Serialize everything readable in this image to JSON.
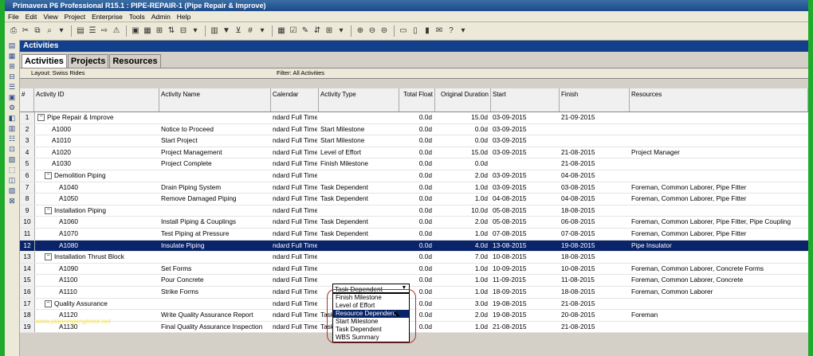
{
  "app": {
    "title": "Primavera P6 Professional R15.1 : PIPE-REPAIR-1 (Pipe Repair & Improve)"
  },
  "menu": [
    "File",
    "Edit",
    "View",
    "Project",
    "Enterprise",
    "Tools",
    "Admin",
    "Help"
  ],
  "section": {
    "title": "Activities"
  },
  "tabs": [
    "Activities",
    "Projects",
    "Resources"
  ],
  "filterbar": {
    "layout": "Layout: Swiss Rides",
    "filter": "Filter: All Activities"
  },
  "columns": {
    "num": "#",
    "id": "Activity ID",
    "name": "Activity Name",
    "calendar": "Calendar",
    "type": "Activity Type",
    "float": "Total Float",
    "duration": "Original Duration",
    "start": "Start",
    "finish": "Finish",
    "resources": "Resources"
  },
  "rows": [
    {
      "num": "1",
      "indent": 0,
      "exp": "−",
      "id": "Pipe Repair & Improve",
      "name": "",
      "cal": "ndard Full Time",
      "type": "",
      "float": "0.0d",
      "dur": "15.0d",
      "start": "03-09-2015",
      "finish": "21-09-2015",
      "res": ""
    },
    {
      "num": "2",
      "indent": 2,
      "exp": "",
      "id": "A1000",
      "name": "Notice to Proceed",
      "cal": "ndard Full Time",
      "type": "Start Milestone",
      "float": "0.0d",
      "dur": "0.0d",
      "start": "03-09-2015",
      "finish": "",
      "res": ""
    },
    {
      "num": "3",
      "indent": 2,
      "exp": "",
      "id": "A1010",
      "name": "Start Project",
      "cal": "ndard Full Time",
      "type": "Start Milestone",
      "float": "0.0d",
      "dur": "0.0d",
      "start": "03-09-2015",
      "finish": "",
      "res": ""
    },
    {
      "num": "4",
      "indent": 2,
      "exp": "",
      "id": "A1020",
      "name": "Project Management",
      "cal": "ndard Full Time",
      "type": "Level of Effort",
      "float": "0.0d",
      "dur": "15.0d",
      "start": "03-09-2015",
      "finish": "21-08-2015",
      "res": "Project Manager"
    },
    {
      "num": "5",
      "indent": 2,
      "exp": "",
      "id": "A1030",
      "name": "Project Complete",
      "cal": "ndard Full Time",
      "type": "Finish Milestone",
      "float": "0.0d",
      "dur": "0.0d",
      "start": "",
      "finish": "21-08-2015",
      "res": ""
    },
    {
      "num": "6",
      "indent": 1,
      "exp": "−",
      "id": "Demolition Piping",
      "name": "",
      "cal": "ndard Full Time",
      "type": "",
      "float": "0.0d",
      "dur": "2.0d",
      "start": "03-09-2015",
      "finish": "04-08-2015",
      "res": ""
    },
    {
      "num": "7",
      "indent": 3,
      "exp": "",
      "id": "A1040",
      "name": "Drain Piping System",
      "cal": "ndard Full Time",
      "type": "Task Dependent",
      "float": "0.0d",
      "dur": "1.0d",
      "start": "03-09-2015",
      "finish": "03-08-2015",
      "res": "Foreman, Common Laborer, Pipe Fitter"
    },
    {
      "num": "8",
      "indent": 3,
      "exp": "",
      "id": "A1050",
      "name": "Remove Damaged Piping",
      "cal": "ndard Full Time",
      "type": "Task Dependent",
      "float": "0.0d",
      "dur": "1.0d",
      "start": "04-08-2015",
      "finish": "04-08-2015",
      "res": "Foreman, Common Laborer, Pipe Fitter"
    },
    {
      "num": "9",
      "indent": 1,
      "exp": "−",
      "id": "Installation Piping",
      "name": "",
      "cal": "ndard Full Time",
      "type": "",
      "float": "0.0d",
      "dur": "10.0d",
      "start": "05-08-2015",
      "finish": "18-08-2015",
      "res": ""
    },
    {
      "num": "10",
      "indent": 3,
      "exp": "",
      "id": "A1060",
      "name": "Install Piping & Couplings",
      "cal": "ndard Full Time",
      "type": "Task Dependent",
      "float": "0.0d",
      "dur": "2.0d",
      "start": "05-08-2015",
      "finish": "06-08-2015",
      "res": "Foreman, Common Laborer, Pipe Fitter, Pipe Coupling"
    },
    {
      "num": "11",
      "indent": 3,
      "exp": "",
      "id": "A1070",
      "name": "Test Piping at Pressure",
      "cal": "ndard Full Time",
      "type": "Task Dependent",
      "float": "0.0d",
      "dur": "1.0d",
      "start": "07-08-2015",
      "finish": "07-08-2015",
      "res": "Foreman, Common Laborer, Pipe Fitter"
    },
    {
      "num": "12",
      "indent": 3,
      "exp": "",
      "id": "A1080",
      "name": "Insulate Piping",
      "cal": "ndard Full Time",
      "type": "",
      "float": "0.0d",
      "dur": "4.0d",
      "start": "13-08-2015",
      "finish": "19-08-2015",
      "res": "Pipe Insulator",
      "selected": true
    },
    {
      "num": "13",
      "indent": 1,
      "exp": "−",
      "id": "Installation Thrust Block",
      "name": "",
      "cal": "ndard Full Time",
      "type": "",
      "float": "0.0d",
      "dur": "7.0d",
      "start": "10-08-2015",
      "finish": "18-08-2015",
      "res": ""
    },
    {
      "num": "14",
      "indent": 3,
      "exp": "",
      "id": "A1090",
      "name": "Set Forms",
      "cal": "ndard Full Time",
      "type": "",
      "float": "0.0d",
      "dur": "1.0d",
      "start": "10-09-2015",
      "finish": "10-08-2015",
      "res": "Foreman, Common Laborer, Concrete Forms"
    },
    {
      "num": "15",
      "indent": 3,
      "exp": "",
      "id": "A1100",
      "name": "Pour Concrete",
      "cal": "ndard Full Time",
      "type": "",
      "float": "0.0d",
      "dur": "1.0d",
      "start": "11-09-2015",
      "finish": "11-08-2015",
      "res": "Foreman, Common Laborer, Concrete"
    },
    {
      "num": "16",
      "indent": 3,
      "exp": "",
      "id": "A1110",
      "name": "Strike Forms",
      "cal": "ndard Full Time",
      "type": "",
      "float": "0.0d",
      "dur": "1.0d",
      "start": "18-09-2015",
      "finish": "18-08-2015",
      "res": "Foreman, Common Laborer"
    },
    {
      "num": "17",
      "indent": 1,
      "exp": "−",
      "id": "Quality Assurance",
      "name": "",
      "cal": "ndard Full Time",
      "type": "",
      "float": "0.0d",
      "dur": "3.0d",
      "start": "19-08-2015",
      "finish": "21-08-2015",
      "res": ""
    },
    {
      "num": "18",
      "indent": 3,
      "exp": "",
      "id": "A1120",
      "name": "Write Quality Assurance Report",
      "cal": "ndard Full Time",
      "type": "Task Dependent",
      "float": "0.0d",
      "dur": "2.0d",
      "start": "19-08-2015",
      "finish": "20-08-2015",
      "res": "Foreman"
    },
    {
      "num": "19",
      "indent": 3,
      "exp": "",
      "id": "A1130",
      "name": "Final Quality Assurance Inspection",
      "cal": "ndard Full Time",
      "type": "Task Dependent",
      "float": "0.0d",
      "dur": "1.0d",
      "start": "21-08-2015",
      "finish": "21-08-2015",
      "res": ""
    }
  ],
  "combo": {
    "value": "Task Dependent",
    "arrow": "▼"
  },
  "dropdown": {
    "options": [
      "Finish Milestone",
      "Level of Effort",
      "Resource Dependent",
      "Start Milestone",
      "Task Dependent",
      "WBS Summary"
    ],
    "highlighted": 2
  },
  "watermark": "www.planningengineer.net"
}
